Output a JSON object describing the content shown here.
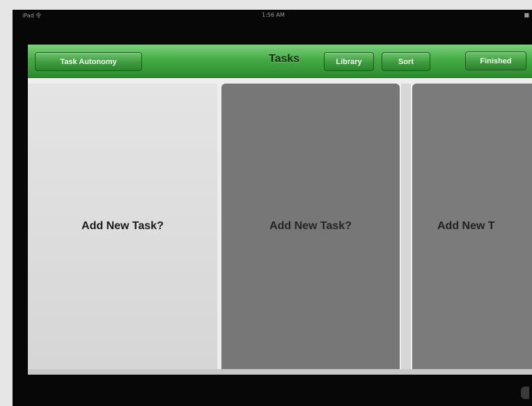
{
  "status_bar": {
    "left": "iPad 令",
    "center": "1:56 AM",
    "right": "■"
  },
  "toolbar": {
    "left_button": "Task Autonomy",
    "title": "Tasks",
    "buttons": [
      "Library",
      "Sort",
      "Finished"
    ]
  },
  "cards": [
    {
      "label": "Add New Task?"
    },
    {
      "label": "Add New Task?"
    },
    {
      "label": "Add New T"
    }
  ],
  "colors": {
    "toolbar_green": "#45ac45",
    "card_light": "#dcdcdc",
    "card_dark": "#777777"
  }
}
